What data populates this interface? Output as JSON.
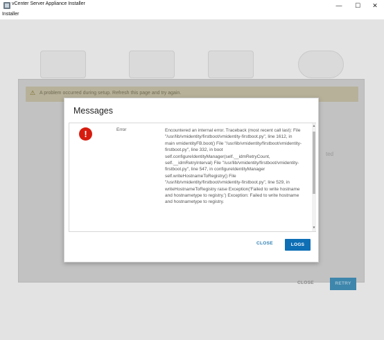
{
  "window": {
    "title": "vCenter Server Appliance Installer",
    "minimize_glyph": "—",
    "maximize_glyph": "☐",
    "close_glyph": "✕"
  },
  "menu": {
    "installer": "Installer"
  },
  "background": {
    "alert_text": "A problem occurred during setup. Refresh this page and try again.",
    "side_label": "ted",
    "close_button": "CLOSE",
    "retry_button": "RETRY"
  },
  "modal": {
    "title": "Messages",
    "messages": [
      {
        "icon": "error-icon",
        "severity": "Error",
        "text": "Encountered an internal error. Traceback (most recent call last): File \"/usr/lib/vmidentity/firstboot/vmidentity-firstboot.py\", line 1612, in main vmidentityFB.boot() File \"/usr/lib/vmidentity/firstboot/vmidentity-firstboot.py\", line 332, in boot self.configureIdentityManager(self.__idmRetryCount, self.__idmRetryInterval) File \"/usr/lib/vmidentity/firstboot/vmidentity-firstboot.py\", line 547, in configureIdentityManager self.writeHostnameToRegistry() File \"/usr/lib/vmidentity/firstboot/vmidentity-firstboot.py\", line 529, in writeHostnameToRegistry raise Exception('Failed to write hostname and hostnametype to registry.') Exception: Failed to write hostname and hostnametype to registry."
      }
    ],
    "close_button": "CLOSE",
    "logs_button": "LOGS"
  },
  "colors": {
    "accent": "#0e6fb5",
    "error": "#d61c0f",
    "overlay": "#e3e3e3"
  }
}
